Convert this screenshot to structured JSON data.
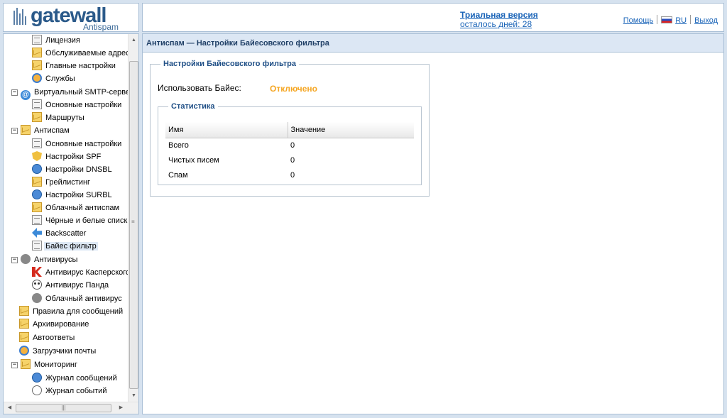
{
  "logo": {
    "word": "gatewall",
    "sub": "Antispam"
  },
  "header": {
    "trial_title": "Триальная версия",
    "trial_days": "осталось дней: 28",
    "help": "Помощь",
    "lang": "RU",
    "logout": "Выход"
  },
  "sidebar": {
    "items": [
      {
        "label": "Лицензия",
        "icon": "doc-icon"
      },
      {
        "label": "Обслуживаемые адреса",
        "icon": "mail-icon"
      },
      {
        "label": "Главные настройки",
        "icon": "mail-settings-icon"
      },
      {
        "label": "Службы",
        "icon": "gear-icon"
      },
      {
        "label": "Виртуальный SMTP-сервер",
        "icon": "at-icon"
      },
      {
        "label": "Основные настройки",
        "icon": "settings-icon"
      },
      {
        "label": "Маршруты",
        "icon": "routes-icon"
      },
      {
        "label": "Антиспам",
        "icon": "antispam-icon"
      },
      {
        "label": "Основные настройки",
        "icon": "settings-icon"
      },
      {
        "label": "Настройки SPF",
        "icon": "shield-icon"
      },
      {
        "label": "Настройки DNSBL",
        "icon": "globe-icon"
      },
      {
        "label": "Грейлистинг",
        "icon": "mail-icon"
      },
      {
        "label": "Настройки SURBL",
        "icon": "globe-icon"
      },
      {
        "label": "Облачный антиспам",
        "icon": "cloud-icon"
      },
      {
        "label": "Чёрные и белые списки",
        "icon": "doc-icon"
      },
      {
        "label": "Backscatter",
        "icon": "arrow-icon"
      },
      {
        "label": "Байес фильтр",
        "icon": "doc-icon"
      },
      {
        "label": "Антивирусы",
        "icon": "bug-icon"
      },
      {
        "label": "Антивирус Касперского",
        "icon": "kaspersky-icon"
      },
      {
        "label": "Антивирус Панда",
        "icon": "panda-icon"
      },
      {
        "label": "Облачный антивирус",
        "icon": "bug-icon"
      },
      {
        "label": "Правила для сообщений",
        "icon": "mail-icon"
      },
      {
        "label": "Архивирование",
        "icon": "mail-icon"
      },
      {
        "label": "Автоответы",
        "icon": "mail-icon"
      },
      {
        "label": "Загрузчики почты",
        "icon": "gear-icon"
      },
      {
        "label": "Мониторинг",
        "icon": "mail-icon"
      },
      {
        "label": "Журнал сообщений",
        "icon": "globe-icon"
      },
      {
        "label": "Журнал событий",
        "icon": "clock-icon"
      }
    ]
  },
  "main": {
    "page_title": "Антиспам — Настройки Байесовского фильтра",
    "bayes_legend": "Настройки Байесовского фильтра",
    "bayes_label": "Использовать Байес:",
    "bayes_value": "Отключено",
    "stats_legend": "Статистика",
    "stats_headers": [
      "Имя",
      "Значение"
    ],
    "stats_rows": [
      [
        "Всего",
        "0"
      ],
      [
        "Чистых писем",
        "0"
      ],
      [
        "Спам",
        "0"
      ]
    ]
  },
  "colors": {
    "accent": "#1a64b8",
    "disabled_status": "#f5a623",
    "title_bar": "#dce7f4"
  }
}
